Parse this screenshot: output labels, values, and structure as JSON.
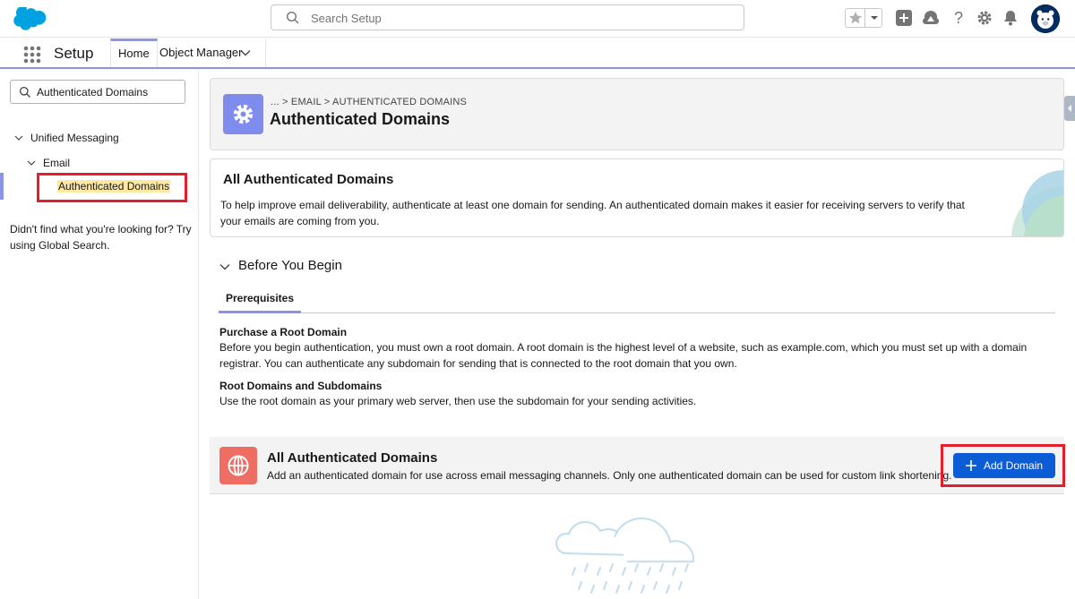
{
  "header": {
    "search_placeholder": "Search Setup",
    "icons": [
      "salesforce-cloud-logo",
      "favorites-star-icon",
      "chevron-down-icon",
      "global-actions-plus-icon",
      "trailhead-icon",
      "help-icon",
      "gear-icon",
      "bell-icon",
      "avatar"
    ]
  },
  "context_bar": {
    "app_name": "Setup",
    "tabs": [
      {
        "label": "Home"
      },
      {
        "label": "Object Manager"
      }
    ]
  },
  "sidebar": {
    "search_value": "Authenticated Domains",
    "tree": {
      "level1": "Unified Messaging",
      "level2": "Email",
      "level3": "Authenticated Domains"
    },
    "note": "Didn't find what you're looking for? Try using Global Search."
  },
  "page_header": {
    "breadcrumb": "... > EMAIL > AUTHENTICATED DOMAINS",
    "title": "Authenticated Domains"
  },
  "info_card": {
    "title": "All Authenticated Domains",
    "text": "To help improve email deliverability, authenticate at least one domain for sending. An authenticated domain makes it easier for receiving servers to verify that your emails are coming from you."
  },
  "before_you_begin": {
    "title": "Before You Begin",
    "tab": "Prerequisites",
    "sections": [
      {
        "heading": "Purchase a Root Domain",
        "text": "Before you begin authentication, you must own a root domain. A root domain is the highest level of a website, such as example.com, which you must set up with a domain registrar. You can authenticate any subdomain for sending that is connected to the root domain that you own."
      },
      {
        "heading": "Root Domains and Subdomains",
        "text": "Use the root domain as your primary web server, then use the subdomain for your sending activities."
      }
    ]
  },
  "list_header": {
    "title": "All Authenticated Domains",
    "text": "Add an authenticated domain for use across email messaging channels. Only one authenticated domain can be used for custom link shortening.",
    "add_button": "Add Domain"
  },
  "colors": {
    "brand_blue": "#0b5cd5",
    "setup_icon": "#7f8ced",
    "domain_icon": "#ef6e64",
    "highlight_red": "#e2202d",
    "tab_accent": "#8b95e8"
  }
}
